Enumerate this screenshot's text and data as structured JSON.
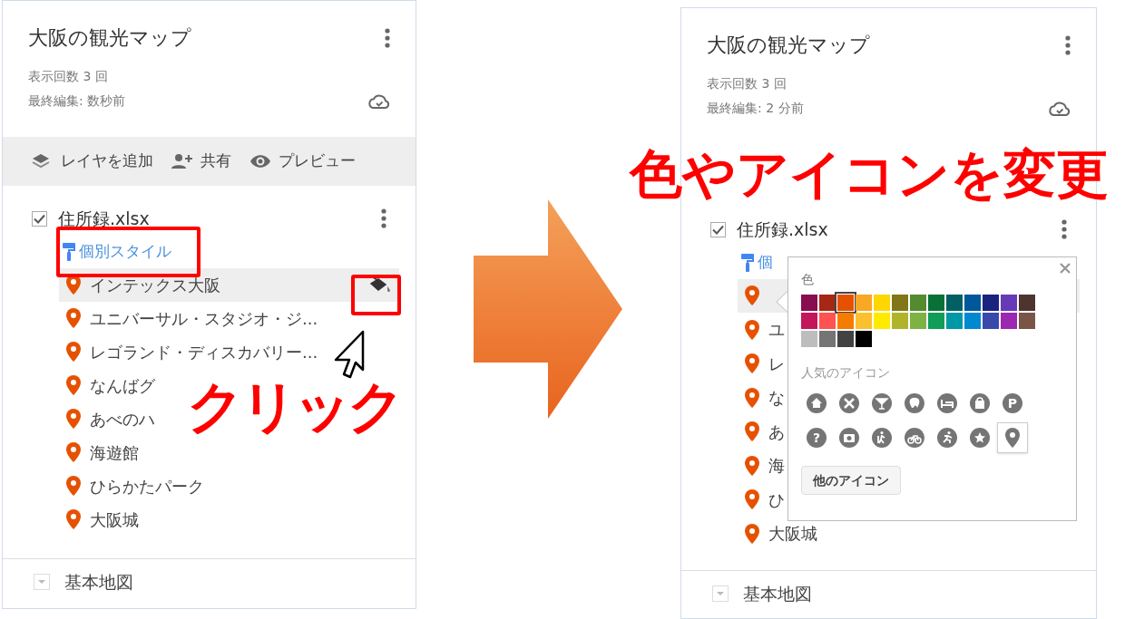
{
  "before_screen": {
    "title": "大阪の観光マップ",
    "views": "表示回数 3 回",
    "last_edit": "最終編集: 数秒前",
    "toolbar": [
      {
        "kind": "layers",
        "label": "レイヤを追加"
      },
      {
        "kind": "share",
        "label": "共有"
      },
      {
        "kind": "preview",
        "label": "プレビュー"
      }
    ],
    "layer": {
      "name": "住所録.xlsx",
      "checked": true
    },
    "style_link": "個別スタイル",
    "places": [
      {
        "name": "インテックス大阪",
        "highlighted": true
      },
      {
        "name": "ユニバーサル・スタジオ・ジ...",
        "highlighted": false
      },
      {
        "name": "レゴランド・ディスカバリー...",
        "highlighted": false
      },
      {
        "name": "なんばグ",
        "highlighted": false
      },
      {
        "name": "あべのハ",
        "highlighted": false
      },
      {
        "name": "海遊館",
        "highlighted": false
      },
      {
        "name": "ひらかたパーク",
        "highlighted": false
      },
      {
        "name": "大阪城",
        "highlighted": false
      }
    ],
    "base_map": "基本地図"
  },
  "click_caption": "クリック",
  "change_caption": "色やアイコンを変更",
  "after_screen": {
    "title": "大阪の観光マップ",
    "views": "表示回数 3 回",
    "last_edit": "最終編集: 2 分前",
    "layer": {
      "name": "住所録.xlsx",
      "checked": true
    },
    "style_link": "個",
    "places": [
      {
        "highlighted": true
      },
      {
        "name": "ユ",
        "highlighted": false
      },
      {
        "name": "レ",
        "highlighted": false
      },
      {
        "name": "な",
        "highlighted": false
      },
      {
        "name": "あ",
        "highlighted": false
      },
      {
        "name": "海",
        "highlighted": false
      },
      {
        "name": "ひ",
        "highlighted": false
      },
      {
        "name": "大阪城",
        "highlighted": false
      }
    ],
    "base_map": "基本地図",
    "style_popup": {
      "color_label": "色",
      "colors": [
        {
          "color": "#880e4f",
          "selected": false
        },
        {
          "color": "#a52714",
          "selected": false
        },
        {
          "color": "#e65100",
          "selected": true
        },
        {
          "color": "#f9a825",
          "selected": false
        },
        {
          "color": "#ffd600",
          "selected": false
        },
        {
          "color": "#817717",
          "selected": false
        },
        {
          "color": "#558b2f",
          "selected": false
        },
        {
          "color": "#097138",
          "selected": false
        },
        {
          "color": "#006064",
          "selected": false
        },
        {
          "color": "#01579b",
          "selected": false
        },
        {
          "color": "#1a237e",
          "selected": false
        },
        {
          "color": "#673ab7",
          "selected": false
        },
        {
          "color": "#4e342e",
          "selected": false
        },
        {
          "color": "#c2185b",
          "selected": false
        },
        {
          "color": "#ff5252",
          "selected": false
        },
        {
          "color": "#f57c00",
          "selected": false
        },
        {
          "color": "#fbc02d",
          "selected": false
        },
        {
          "color": "#ffea00",
          "selected": false
        },
        {
          "color": "#afb42b",
          "selected": false
        },
        {
          "color": "#7cb342",
          "selected": false
        },
        {
          "color": "#0f9d58",
          "selected": false
        },
        {
          "color": "#0097a7",
          "selected": false
        },
        {
          "color": "#0288d1",
          "selected": false
        },
        {
          "color": "#3949ab",
          "selected": false
        },
        {
          "color": "#9c27b0",
          "selected": false
        },
        {
          "color": "#795548",
          "selected": false
        },
        {
          "color": "#bdbdbd",
          "selected": false
        },
        {
          "color": "#757575",
          "selected": false
        },
        {
          "color": "#424242",
          "selected": false
        },
        {
          "color": "#000000",
          "selected": false
        }
      ],
      "icons_label": "人気のアイコン",
      "icons": [
        {
          "kind": "home",
          "selected": false
        },
        {
          "kind": "food",
          "selected": false
        },
        {
          "kind": "bar",
          "selected": false
        },
        {
          "kind": "tooth",
          "selected": false
        },
        {
          "kind": "bed",
          "selected": false
        },
        {
          "kind": "bag",
          "selected": false
        },
        {
          "kind": "parking",
          "glyph": "P",
          "selected": false
        },
        {
          "kind": "question",
          "glyph": "?",
          "selected": false
        },
        {
          "kind": "camera",
          "selected": false
        },
        {
          "kind": "hiker",
          "selected": false
        },
        {
          "kind": "bicycle",
          "selected": false
        },
        {
          "kind": "runner",
          "selected": false
        },
        {
          "kind": "star",
          "selected": false
        },
        {
          "kind": "pin",
          "selected": true
        }
      ],
      "more_button": "他のアイコン"
    }
  }
}
